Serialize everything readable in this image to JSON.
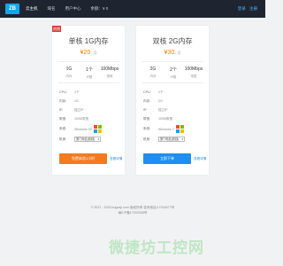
{
  "header": {
    "logo_text": "ZB",
    "nav": [
      "云主机",
      "域名",
      "用户中心",
      "余额：¥ 0"
    ],
    "login": "登录",
    "register": "注册"
  },
  "plans": [
    {
      "badge": "热销",
      "title": "单核 1G内存",
      "price": "¥20",
      "unit": "/ 月",
      "specs": [
        {
          "value": "1G",
          "label": "内存"
        },
        {
          "value": "1个",
          "label": "IP数"
        },
        {
          "value": "100Mbps",
          "label": "带宽"
        }
      ],
      "rows": [
        {
          "k": "CPU:",
          "v": "1个"
        },
        {
          "k": "内存:",
          "v": "1G"
        },
        {
          "k": "IP:",
          "v": "独立IP"
        },
        {
          "k": "带宽:",
          "v": "100M带宽"
        }
      ],
      "system_label": "系统:",
      "system_name": "Windows XP",
      "location_label": "机房:",
      "location_value": "厦门电信(双线)",
      "button": "免费体验1小时",
      "more": "查看详情"
    },
    {
      "badge": "",
      "title": "双核 2G内存",
      "price": "¥30",
      "unit": "/ 月",
      "specs": [
        {
          "value": "2G",
          "label": "内存"
        },
        {
          "value": "2个",
          "label": "IP数"
        },
        {
          "value": "100Mbps",
          "label": "带宽"
        }
      ],
      "rows": [
        {
          "k": "CPU:",
          "v": "2个"
        },
        {
          "k": "内存:",
          "v": "2G"
        },
        {
          "k": "IP:",
          "v": "独立IP"
        },
        {
          "k": "带宽:",
          "v": "100M带宽"
        }
      ],
      "system_label": "系统:",
      "system_name": "Windows 7",
      "location_label": "机房:",
      "location_value": "厦门电信(双线)",
      "button": "立即下单",
      "more": "查看详情"
    }
  ],
  "footer": {
    "line1": "© 2017 - 2025 bugueji.com 版权所有  咨询电话:17018477号",
    "line2": "闽ICP备17002938号"
  },
  "watermark": "微捷坊工控网",
  "colors": {
    "topbar": "#1f2530",
    "accent_orange": "#f47a20",
    "accent_blue": "#1e8ff0",
    "badge_red": "#e63333"
  }
}
